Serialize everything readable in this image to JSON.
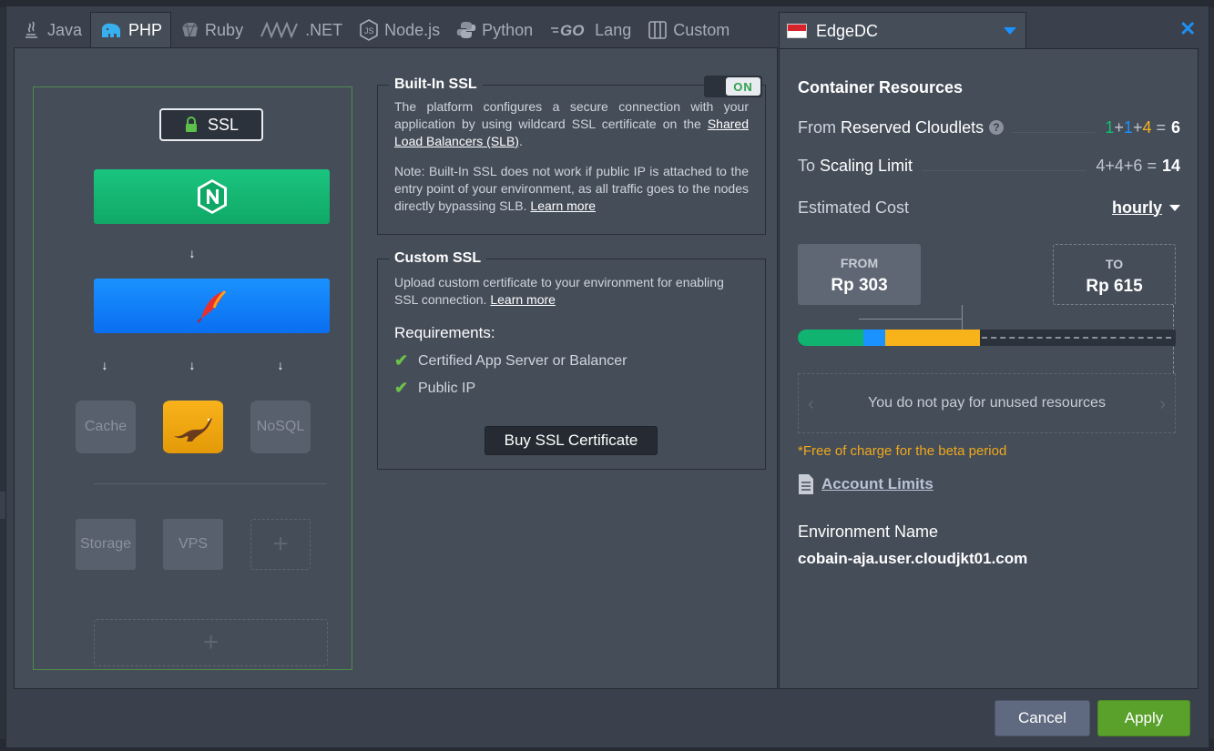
{
  "tabs": [
    {
      "label": "Java",
      "icon": "java-icon"
    },
    {
      "label": "PHP",
      "icon": "php-elephant-icon",
      "active": true
    },
    {
      "label": "Ruby",
      "icon": "ruby-icon"
    },
    {
      "label": ".NET",
      "icon": "dotnet-icon"
    },
    {
      "label": "Node.js",
      "icon": "nodejs-icon"
    },
    {
      "label": "Python",
      "icon": "python-icon"
    },
    {
      "label": "Lang",
      "icon": "go-icon"
    },
    {
      "label": "Custom",
      "icon": "custom-icon"
    }
  ],
  "topology": {
    "ssl_label": "SSL",
    "db_cache": "Cache",
    "db_nosql": "NoSQL",
    "storage": "Storage",
    "vps": "VPS"
  },
  "builtin_ssl": {
    "title": "Built-In SSL",
    "toggle": "ON",
    "p1_text": "The platform configures a secure connection with your application by using wildcard SSL certificate on the",
    "p1_link": "Shared Load Balancers (SLB)",
    "p2_text": "Note: Built-In SSL does not work if public IP is attached to the entry point of your environment, as all traffic goes to the nodes directly bypassing SLB.",
    "p2_link": "Learn more"
  },
  "custom_ssl": {
    "title": "Custom SSL",
    "p_text": "Upload custom certificate to your environment for enabling SSL connection.",
    "p_link": "Learn more",
    "req_title": "Requirements:",
    "req1": "Certified App Server or Balancer",
    "req2": "Public IP",
    "buy_button": "Buy SSL Certificate"
  },
  "region": {
    "name": "EdgeDC"
  },
  "resources": {
    "title": "Container Resources",
    "from_prefix": "From",
    "from_label": "Reserved Cloudlets",
    "from_calc_a": "1",
    "from_calc_b": "1",
    "from_calc_c": "4",
    "from_total": "6",
    "to_prefix": "To",
    "to_label": "Scaling Limit",
    "to_calc": "4+4+6 =",
    "to_total": "14",
    "cost_label": "Estimated Cost",
    "cost_period": "hourly",
    "from_price_label": "FROM",
    "from_price": "Rp 303",
    "to_price_label": "TO",
    "to_price": "Rp 615",
    "unused_note": "You do not pay for unused resources",
    "free_note": "*Free of charge for the beta period",
    "limits_link": "Account Limits",
    "env_name_label": "Environment Name",
    "env_name": "cobain-aja.user.cloudjkt01.com"
  },
  "usage_bar": {
    "green": 1,
    "blue": 1,
    "orange": 4,
    "scaling_limit": 14
  },
  "colors": {
    "accent": "#1a92ff",
    "green": "#10b36f",
    "orange": "#f8b21a",
    "apply": "#5aa12c"
  },
  "footer": {
    "cancel": "Cancel",
    "apply": "Apply"
  }
}
